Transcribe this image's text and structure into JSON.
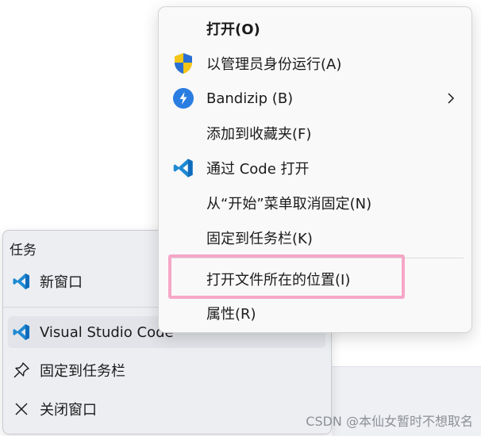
{
  "context_menu": {
    "items": [
      {
        "label": "打开(O)",
        "bold": true,
        "icon": ""
      },
      {
        "label": "以管理员身份运行(A)",
        "icon": "uac-shield-icon"
      },
      {
        "label": "Bandizip (B)",
        "icon": "bandizip-icon",
        "submenu": true
      },
      {
        "label": "添加到收藏夹(F)",
        "icon": ""
      },
      {
        "label": "通过 Code 打开",
        "icon": "vscode-icon"
      },
      {
        "label": "从“开始”菜单取消固定(N)",
        "icon": ""
      },
      {
        "label": "固定到任务栏(K)",
        "icon": ""
      },
      {
        "label": "打开文件所在的位置(I)",
        "icon": "",
        "highlighted": true
      },
      {
        "label": "属性(R)",
        "icon": ""
      }
    ],
    "highlight_color": "#f6a7c7"
  },
  "jumplist": {
    "section_title": "任务",
    "tasks": [
      {
        "label": "新窗口",
        "icon": "vscode-icon"
      }
    ],
    "app": {
      "label": "Visual Studio Code",
      "icon": "vscode-icon"
    },
    "actions": [
      {
        "label": "固定到任务栏",
        "icon": "pin-icon"
      },
      {
        "label": "关闭窗口",
        "icon": "close-icon"
      }
    ]
  },
  "watermark": "CSDN @本仙女暂时不想取名",
  "colors": {
    "vscode_blue": "#1f8ad2",
    "bandizip_blue": "#2a7de1",
    "shield_yellow": "#f5c518",
    "shield_blue": "#2a6fd6"
  }
}
